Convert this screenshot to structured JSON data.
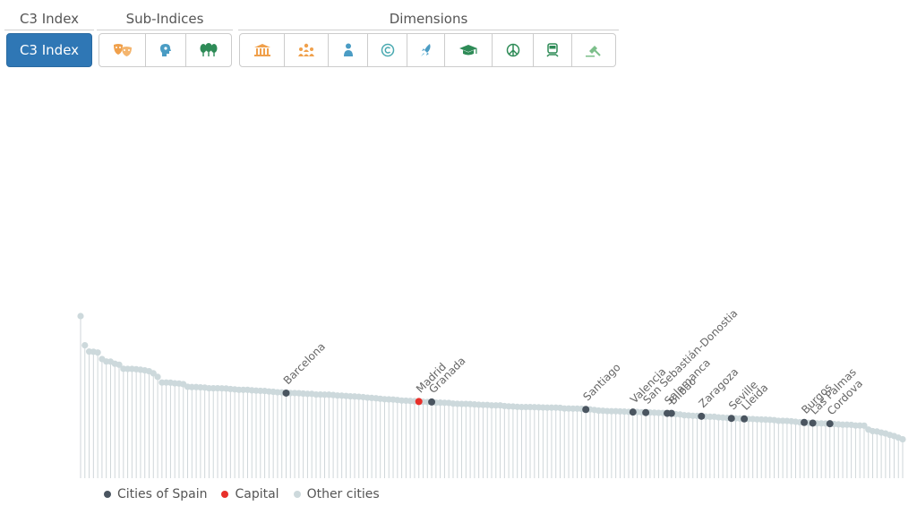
{
  "header": {
    "group_c3": "C3 Index",
    "group_sub": "Sub-Indices",
    "group_dim": "Dimensions",
    "c3_button": "C3 Index"
  },
  "subindex_icons": [
    "masks-icon",
    "head-icon",
    "trees-icon"
  ],
  "dimension_icons": [
    "museum-icon",
    "people-icon",
    "person-icon",
    "copyright-icon",
    "rocket-icon",
    "graduation-cap-icon",
    "peace-icon",
    "train-icon",
    "gavel-icon"
  ],
  "colors": {
    "primary_button": "#2f77b5",
    "icon_orange": "#f0a04b",
    "icon_blue": "#4a9cc4",
    "icon_teal": "#49a9b0",
    "icon_green": "#2e8b57",
    "icon_light_green": "#7cbf8a",
    "spain": "#4a5560",
    "capital": "#e8302a",
    "other": "#cdd9dc"
  },
  "legend": {
    "spain": "Cities of Spain",
    "capital": "Capital",
    "other": "Other cities"
  },
  "chart_data": {
    "type": "lollipop",
    "title": "",
    "xlabel": "",
    "ylabel": "",
    "ylim": [
      0,
      100
    ],
    "grid": false,
    "legend_position": "bottom-left",
    "city_count": 190,
    "values": [
      100,
      82,
      78.1,
      78,
      77.5,
      73.5,
      72,
      71.9,
      70.6,
      70,
      67.5,
      67.4,
      67.4,
      67.2,
      66.9,
      66.5,
      66,
      64.7,
      62.5,
      59,
      59,
      58.9,
      58.5,
      58.4,
      58,
      56.4,
      56.2,
      56.2,
      56,
      55.9,
      55.5,
      55.5,
      55.5,
      55.4,
      55.3,
      55,
      54.8,
      54.5,
      54.5,
      54.5,
      54.2,
      54,
      53.9,
      53.8,
      53.5,
      53.3,
      53,
      52.9,
      52.5,
      52.5,
      52.5,
      52.4,
      52.2,
      52,
      52,
      51.6,
      51.6,
      51.5,
      51.5,
      51.3,
      51,
      50.9,
      50.7,
      50.5,
      50.4,
      50.2,
      50,
      49.7,
      49.5,
      49.3,
      49,
      48.7,
      48.6,
      48.5,
      48.2,
      47.9,
      47.8,
      47.7,
      47.5,
      47.3,
      47.1,
      47,
      47,
      46.6,
      46.6,
      46.5,
      46.4,
      46,
      45.9,
      45.8,
      45.8,
      45.7,
      45.5,
      45.3,
      45.2,
      45.2,
      44.9,
      44.9,
      44.9,
      44.5,
      44.3,
      44.2,
      44,
      43.9,
      43.9,
      43.9,
      43.8,
      43.7,
      43.6,
      43.5,
      43.5,
      43.5,
      43.4,
      43,
      43,
      42.9,
      42.9,
      42.8,
      42.4,
      42.4,
      42.1,
      41.7,
      41.6,
      41.4,
      41.3,
      41.3,
      41.2,
      41.1,
      40.9,
      40.8,
      40.8,
      40.6,
      40.5,
      40.5,
      40.4,
      40.3,
      40.2,
      40,
      40,
      39.5,
      39.3,
      38.8,
      38.7,
      38.5,
      38.4,
      38.2,
      38,
      37.9,
      37.9,
      37.5,
      37.4,
      37.2,
      36.9,
      36.9,
      36.8,
      36.6,
      36.5,
      36.5,
      36.3,
      36.2,
      36.1,
      36,
      35.8,
      35.4,
      35.4,
      35.3,
      35.1,
      34.8,
      34.5,
      34.4,
      34.1,
      34,
      33.8,
      33.8,
      33.7,
      33.6,
      33.4,
      33.2,
      33,
      33,
      32.9,
      32.5,
      32.5,
      32.4,
      30,
      29,
      28.8,
      28.1,
      27.6,
      26.7,
      26,
      25,
      24
    ],
    "series": [
      {
        "name": "Cities of Spain",
        "points": [
          {
            "rank": 48,
            "label": "Barcelona"
          },
          {
            "rank": 82,
            "label": "Granada"
          },
          {
            "rank": 118,
            "label": "Santiago"
          },
          {
            "rank": 129,
            "label": "Valencia"
          },
          {
            "rank": 132,
            "label": "San Sebastián-Donostia"
          },
          {
            "rank": 137,
            "label": "Salamanca"
          },
          {
            "rank": 138,
            "label": "Bilbao"
          },
          {
            "rank": 145,
            "label": "Zaragoza"
          },
          {
            "rank": 152,
            "label": "Seville"
          },
          {
            "rank": 155,
            "label": "Lleida"
          },
          {
            "rank": 169,
            "label": "Burgos"
          },
          {
            "rank": 171,
            "label": "Las Palmas"
          },
          {
            "rank": 175,
            "label": "Cordova"
          }
        ]
      },
      {
        "name": "Capital",
        "points": [
          {
            "rank": 79,
            "label": "Madrid"
          }
        ]
      },
      {
        "name": "Other cities",
        "points": []
      }
    ]
  }
}
